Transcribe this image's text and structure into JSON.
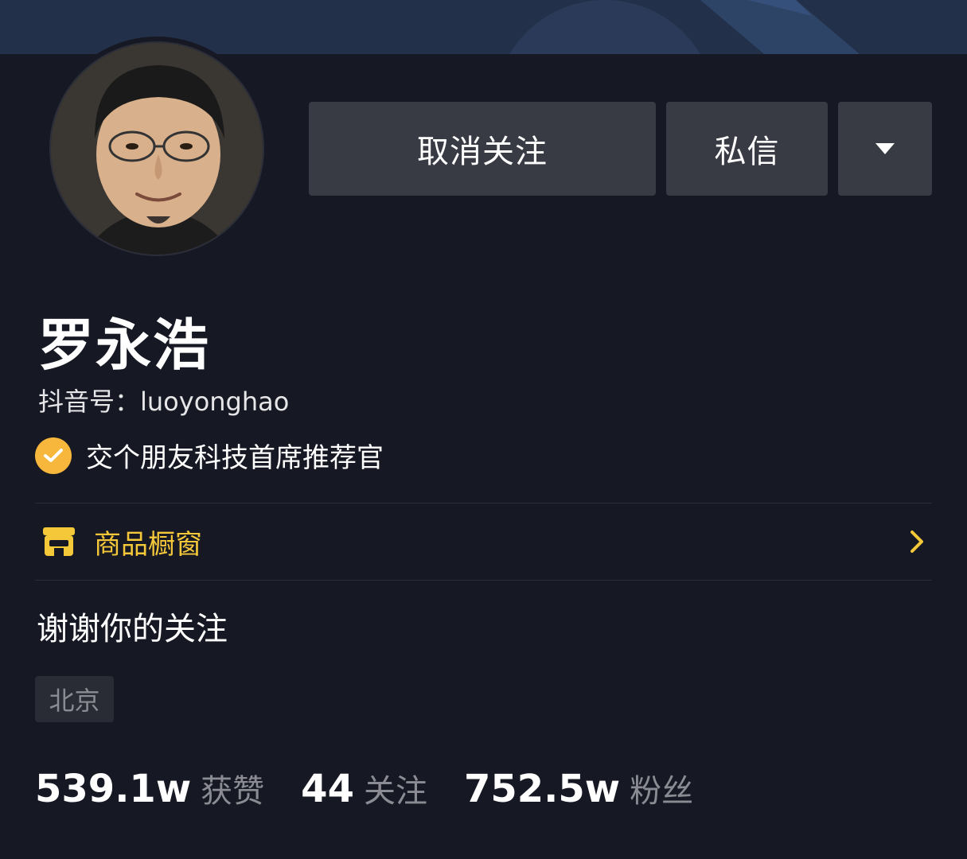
{
  "header": {
    "banner_color": "#22304a"
  },
  "profile": {
    "avatar_icon": "avatar-photo",
    "name": "罗永浩",
    "douyin_id": "抖音号：luoyonghao",
    "verification": {
      "icon": "check-badge-icon",
      "text": "交个朋友科技首席推荐官",
      "color": "#f6b73c"
    },
    "bio": "谢谢你的关注",
    "location_tag": "北京"
  },
  "actions": {
    "unfollow_label": "取消关注",
    "message_label": "私信",
    "more_icon": "caret-down-icon"
  },
  "shop": {
    "icon": "storefront-icon",
    "label": "商品橱窗",
    "chevron": "chevron-right-icon",
    "color": "#f5c83a"
  },
  "stats": [
    {
      "value": "539.1w",
      "label": "获赞"
    },
    {
      "value": "44",
      "label": "关注"
    },
    {
      "value": "752.5w",
      "label": "粉丝"
    }
  ]
}
